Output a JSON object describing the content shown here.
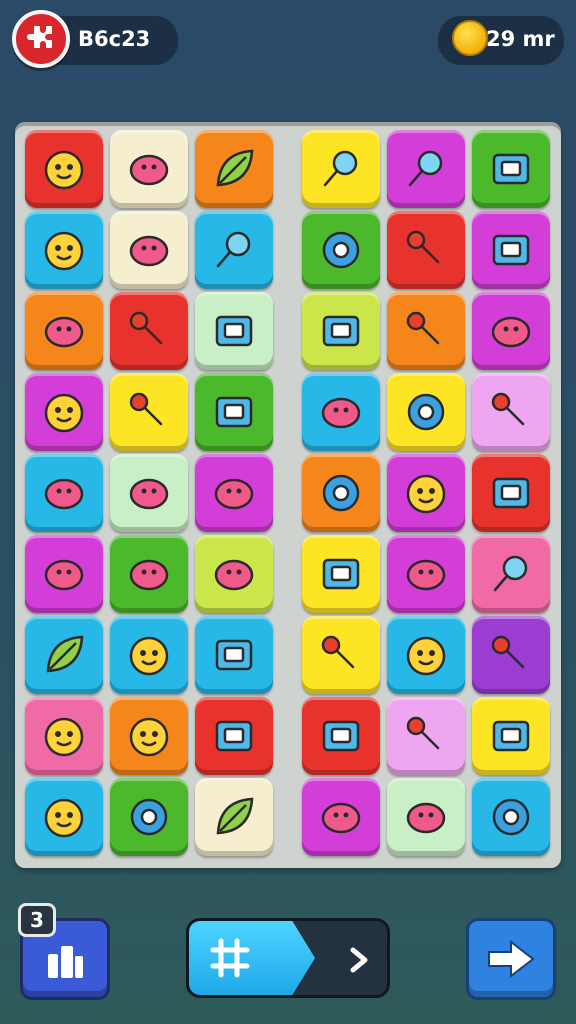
{
  "hud": {
    "score_text": "B6c23",
    "coins_text": "29 mr",
    "level_badge": "3"
  },
  "colors": {
    "red": "#e8322d",
    "cream": "#f6efcf",
    "orange": "#f4861c",
    "yellow": "#fde424",
    "magenta": "#d33ed8",
    "green": "#4cb82c",
    "cyan": "#27b8e8",
    "lime": "#cbe64a",
    "mint": "#c9efc6",
    "pink": "#f06aa6",
    "lilac": "#efa6f0",
    "purple": "#9b3dd1"
  },
  "tiles": [
    [
      "pink-face-icon",
      "clock-icon",
      "feather-icon",
      "key-icon",
      "magnifier-icon",
      "window-icon"
    ],
    [
      "chick-icon",
      "swirl-candy-icon",
      "magnifier-icon",
      "gear-icon",
      "pin-icon",
      "chat-box-icon"
    ],
    [
      "slime-icon",
      "lollipop-icon",
      "robot-icon",
      "safe-icon",
      "bottle-icon",
      "fish-icon"
    ],
    [
      "sun-face-icon",
      "screwdriver-icon",
      "card-icon",
      "network-icon",
      "ring-icon",
      "horn-icon"
    ],
    [
      "door-icon",
      "bean-icon",
      "broom-icon",
      "gear-icon",
      "flower-face-icon",
      "battery-icon"
    ],
    [
      "unicorn-icon",
      "speech-bubble-icon",
      "paper-plane-icon",
      "robot-head-icon",
      "lips-icon",
      "key-icon"
    ],
    [
      "leaf-icon",
      "flower-face-icon",
      "camera-icon",
      "wrench-icon",
      "monster-icon",
      "crayon-icon"
    ],
    [
      "bowl-icon",
      "cat-face-icon",
      "train-icon",
      "cube-icon",
      "rocket-icon",
      "box-icon"
    ],
    [
      "owl-icon",
      "ring-icon",
      "leaf-icon",
      "cheese-icon",
      "sandwich-icon",
      "gear-icon"
    ]
  ],
  "tile_colors": [
    [
      "red",
      "cream",
      "orange",
      "yellow",
      "magenta",
      "green"
    ],
    [
      "cyan",
      "cream",
      "cyan",
      "green",
      "red",
      "magenta"
    ],
    [
      "orange",
      "red",
      "mint",
      "lime",
      "orange",
      "magenta"
    ],
    [
      "magenta",
      "yellow",
      "green",
      "cyan",
      "yellow",
      "lilac"
    ],
    [
      "cyan",
      "mint",
      "magenta",
      "orange",
      "magenta",
      "red"
    ],
    [
      "magenta",
      "green",
      "lime",
      "yellow",
      "magenta",
      "pink"
    ],
    [
      "cyan",
      "cyan",
      "cyan",
      "yellow",
      "cyan",
      "purple"
    ],
    [
      "pink",
      "orange",
      "red",
      "red",
      "lilac",
      "yellow"
    ],
    [
      "cyan",
      "green",
      "cream",
      "magenta",
      "mint",
      "cyan"
    ]
  ]
}
